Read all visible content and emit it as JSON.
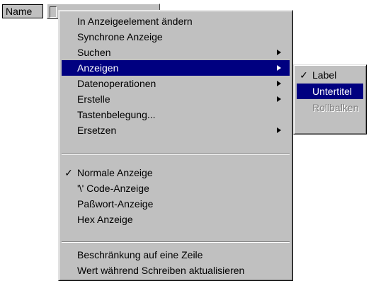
{
  "label": "Name",
  "menu": {
    "items": [
      "In Anzeigeelement ändern",
      "Synchrone Anzeige",
      "Suchen",
      "Anzeigen",
      "Datenoperationen",
      "Erstelle",
      "Tastenbelegung...",
      "Ersetzen",
      "Normale Anzeige",
      "'\\' Code-Anzeige",
      "Paßwort-Anzeige",
      "Hex Anzeige",
      "Beschränkung auf eine Zeile",
      "Wert während Schreiben aktualisieren"
    ],
    "check": "✓"
  },
  "submenu": {
    "items": [
      "Label",
      "Untertitel",
      "Rollbalken"
    ],
    "check": "✓"
  },
  "colors": {
    "highlight": "#000080",
    "menu_bg": "#c0c0c0",
    "disabled_text": "#808080"
  }
}
